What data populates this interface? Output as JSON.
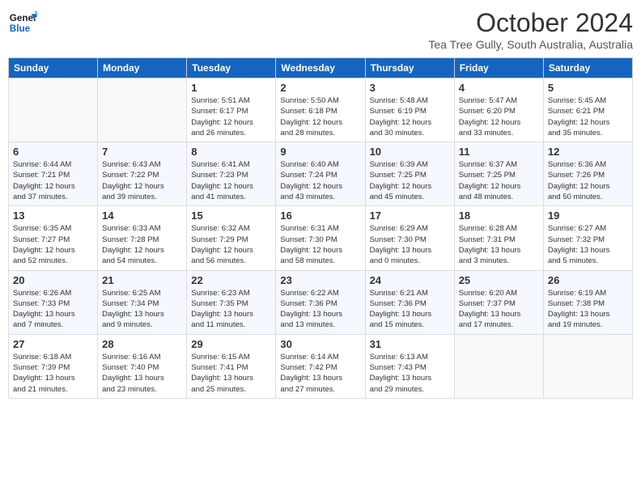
{
  "logo": {
    "line1": "General",
    "line2": "Blue"
  },
  "title": "October 2024",
  "subtitle": "Tea Tree Gully, South Australia, Australia",
  "weekdays": [
    "Sunday",
    "Monday",
    "Tuesday",
    "Wednesday",
    "Thursday",
    "Friday",
    "Saturday"
  ],
  "weeks": [
    [
      {
        "day": "",
        "info": ""
      },
      {
        "day": "",
        "info": ""
      },
      {
        "day": "1",
        "info": "Sunrise: 5:51 AM\nSunset: 6:17 PM\nDaylight: 12 hours\nand 26 minutes."
      },
      {
        "day": "2",
        "info": "Sunrise: 5:50 AM\nSunset: 6:18 PM\nDaylight: 12 hours\nand 28 minutes."
      },
      {
        "day": "3",
        "info": "Sunrise: 5:48 AM\nSunset: 6:19 PM\nDaylight: 12 hours\nand 30 minutes."
      },
      {
        "day": "4",
        "info": "Sunrise: 5:47 AM\nSunset: 6:20 PM\nDaylight: 12 hours\nand 33 minutes."
      },
      {
        "day": "5",
        "info": "Sunrise: 5:45 AM\nSunset: 6:21 PM\nDaylight: 12 hours\nand 35 minutes."
      }
    ],
    [
      {
        "day": "6",
        "info": "Sunrise: 6:44 AM\nSunset: 7:21 PM\nDaylight: 12 hours\nand 37 minutes."
      },
      {
        "day": "7",
        "info": "Sunrise: 6:43 AM\nSunset: 7:22 PM\nDaylight: 12 hours\nand 39 minutes."
      },
      {
        "day": "8",
        "info": "Sunrise: 6:41 AM\nSunset: 7:23 PM\nDaylight: 12 hours\nand 41 minutes."
      },
      {
        "day": "9",
        "info": "Sunrise: 6:40 AM\nSunset: 7:24 PM\nDaylight: 12 hours\nand 43 minutes."
      },
      {
        "day": "10",
        "info": "Sunrise: 6:39 AM\nSunset: 7:25 PM\nDaylight: 12 hours\nand 45 minutes."
      },
      {
        "day": "11",
        "info": "Sunrise: 6:37 AM\nSunset: 7:25 PM\nDaylight: 12 hours\nand 48 minutes."
      },
      {
        "day": "12",
        "info": "Sunrise: 6:36 AM\nSunset: 7:26 PM\nDaylight: 12 hours\nand 50 minutes."
      }
    ],
    [
      {
        "day": "13",
        "info": "Sunrise: 6:35 AM\nSunset: 7:27 PM\nDaylight: 12 hours\nand 52 minutes."
      },
      {
        "day": "14",
        "info": "Sunrise: 6:33 AM\nSunset: 7:28 PM\nDaylight: 12 hours\nand 54 minutes."
      },
      {
        "day": "15",
        "info": "Sunrise: 6:32 AM\nSunset: 7:29 PM\nDaylight: 12 hours\nand 56 minutes."
      },
      {
        "day": "16",
        "info": "Sunrise: 6:31 AM\nSunset: 7:30 PM\nDaylight: 12 hours\nand 58 minutes."
      },
      {
        "day": "17",
        "info": "Sunrise: 6:29 AM\nSunset: 7:30 PM\nDaylight: 13 hours\nand 0 minutes."
      },
      {
        "day": "18",
        "info": "Sunrise: 6:28 AM\nSunset: 7:31 PM\nDaylight: 13 hours\nand 3 minutes."
      },
      {
        "day": "19",
        "info": "Sunrise: 6:27 AM\nSunset: 7:32 PM\nDaylight: 13 hours\nand 5 minutes."
      }
    ],
    [
      {
        "day": "20",
        "info": "Sunrise: 6:26 AM\nSunset: 7:33 PM\nDaylight: 13 hours\nand 7 minutes."
      },
      {
        "day": "21",
        "info": "Sunrise: 6:25 AM\nSunset: 7:34 PM\nDaylight: 13 hours\nand 9 minutes."
      },
      {
        "day": "22",
        "info": "Sunrise: 6:23 AM\nSunset: 7:35 PM\nDaylight: 13 hours\nand 11 minutes."
      },
      {
        "day": "23",
        "info": "Sunrise: 6:22 AM\nSunset: 7:36 PM\nDaylight: 13 hours\nand 13 minutes."
      },
      {
        "day": "24",
        "info": "Sunrise: 6:21 AM\nSunset: 7:36 PM\nDaylight: 13 hours\nand 15 minutes."
      },
      {
        "day": "25",
        "info": "Sunrise: 6:20 AM\nSunset: 7:37 PM\nDaylight: 13 hours\nand 17 minutes."
      },
      {
        "day": "26",
        "info": "Sunrise: 6:19 AM\nSunset: 7:38 PM\nDaylight: 13 hours\nand 19 minutes."
      }
    ],
    [
      {
        "day": "27",
        "info": "Sunrise: 6:18 AM\nSunset: 7:39 PM\nDaylight: 13 hours\nand 21 minutes."
      },
      {
        "day": "28",
        "info": "Sunrise: 6:16 AM\nSunset: 7:40 PM\nDaylight: 13 hours\nand 23 minutes."
      },
      {
        "day": "29",
        "info": "Sunrise: 6:15 AM\nSunset: 7:41 PM\nDaylight: 13 hours\nand 25 minutes."
      },
      {
        "day": "30",
        "info": "Sunrise: 6:14 AM\nSunset: 7:42 PM\nDaylight: 13 hours\nand 27 minutes."
      },
      {
        "day": "31",
        "info": "Sunrise: 6:13 AM\nSunset: 7:43 PM\nDaylight: 13 hours\nand 29 minutes."
      },
      {
        "day": "",
        "info": ""
      },
      {
        "day": "",
        "info": ""
      }
    ]
  ]
}
